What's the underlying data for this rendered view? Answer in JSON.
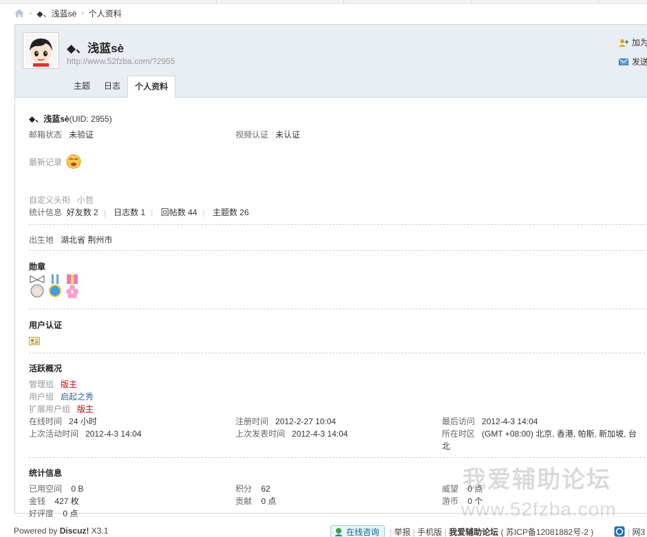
{
  "breadcrumb": {
    "user": "◆、浅蓝sè",
    "page": "个人资料"
  },
  "profile": {
    "name": "◆、浅蓝sè",
    "url": "http://www.52fzba.com/?2955",
    "actions": {
      "add_friend": "加为",
      "send_msg": "发送"
    }
  },
  "tabs": [
    {
      "label": "主题"
    },
    {
      "label": "日志"
    },
    {
      "label": "个人资料"
    }
  ],
  "basic": {
    "title": "◆、浅蓝sè",
    "uid": "(UID: 2955)",
    "email_label": "邮箱状态",
    "email_value": "未验证",
    "video_label": "视频认证",
    "video_value": "未认证",
    "recent_label": "最新记录",
    "custom_title_label": "自定义头衔",
    "custom_title_value": "小哲",
    "stats_label": "统计信息",
    "stats": [
      "好友数 2",
      "日志数 1",
      "回帖数 44",
      "主题数 26"
    ]
  },
  "birthplace": {
    "label": "出生地",
    "value": "湖北省 荆州市"
  },
  "medals": {
    "title": "勋章"
  },
  "verify": {
    "title": "用户认证"
  },
  "activity": {
    "title": "活跃概况",
    "admin_group_label": "管理组",
    "admin_group_value": "版主",
    "user_group_label": "用户组",
    "user_group_value": "启起之秀",
    "ext_group_label": "扩展用户组",
    "ext_group_value": "版主",
    "online_label": "在线时间",
    "online_value": "24 小时",
    "reg_label": "注册时间",
    "reg_value": "2012-2-27 10:04",
    "last_visit_label": "最后访问",
    "last_visit_value": "2012-4-3 14:04",
    "last_active_label": "上次活动时间",
    "last_active_value": "2012-4-3 14:04",
    "last_post_label": "上次发表时间",
    "last_post_value": "2012-4-3 14:04",
    "tz_label": "所在时区",
    "tz_value_1": "(GMT +08:00) 北京, 香港, 帕斯, 新加坡, 台",
    "tz_value_2": "北"
  },
  "statistics": {
    "title": "统计信息",
    "space_label": "已用空间",
    "space_value": "0 B",
    "points_label": "积分",
    "points_value": "62",
    "prestige_label": "威望",
    "prestige_value": "0 点",
    "money_label": "金钱",
    "money_value": "427 枚",
    "contrib_label": "贡献",
    "contrib_value": "0 点",
    "coin_label": "游币",
    "coin_value": "0 个",
    "rating_label": "好评度",
    "rating_value": "0 点"
  },
  "footer": {
    "powered": "Powered by",
    "brand": "Discuz!",
    "version": "X3.1",
    "consult": "在线咨询",
    "report": "举报",
    "mobile": "手机版",
    "site": "我爱辅助论坛",
    "icp": "( 苏ICP备12081882号-2 )",
    "more": "网3"
  },
  "watermark": {
    "line1": "我爱辅助论坛",
    "line2": "www.52fzba.com"
  },
  "colors": {
    "header_bg": "#e8eef3",
    "border": "#c9d7e4",
    "accent_red": "#c00",
    "accent_blue": "#369"
  }
}
